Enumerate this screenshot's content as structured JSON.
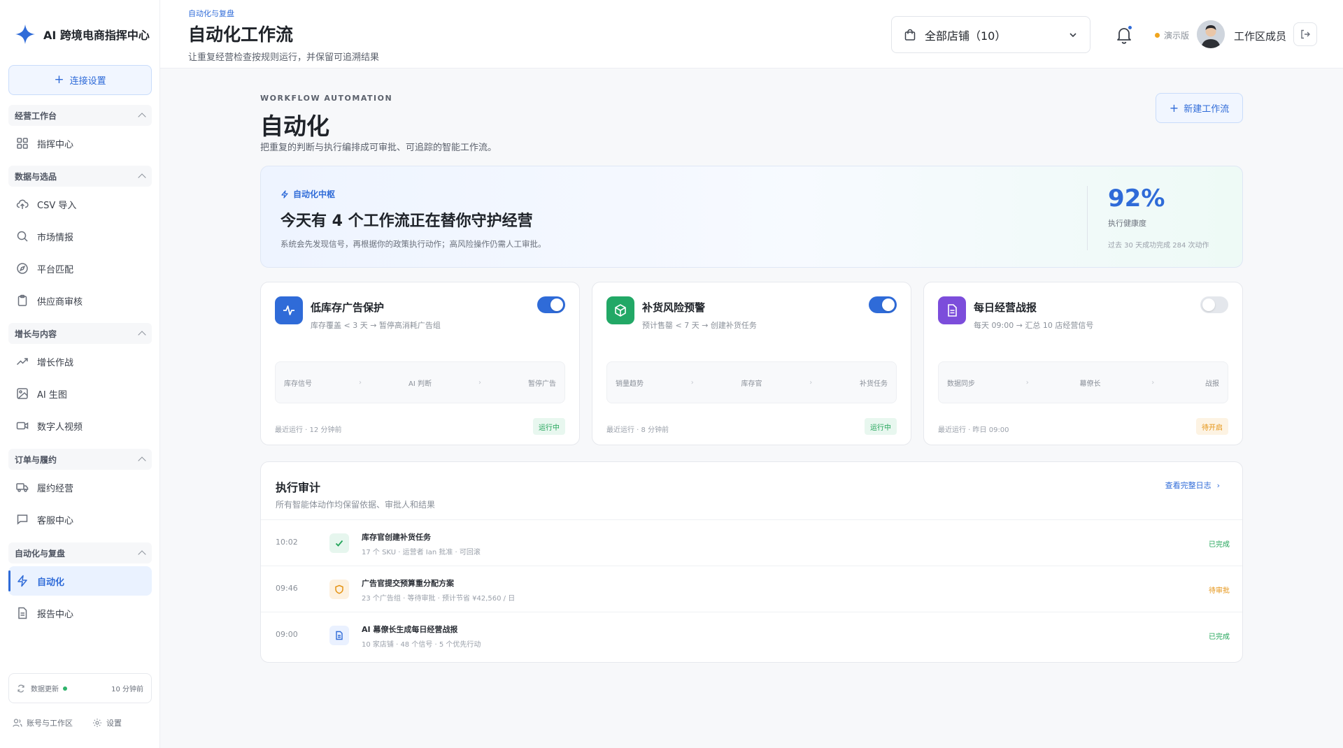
{
  "app": {
    "name": "AI 跨境电商指挥中心"
  },
  "sidebar": {
    "connect_label": "连接设置",
    "groups": [
      {
        "title": "经营工作台",
        "items": [
          {
            "label": "指挥中心",
            "icon": "grid-icon"
          }
        ]
      },
      {
        "title": "数据与选品",
        "items": [
          {
            "label": "CSV 导入",
            "icon": "upload-cloud-icon"
          },
          {
            "label": "市场情报",
            "icon": "search-icon"
          },
          {
            "label": "平台匹配",
            "icon": "compass-icon"
          },
          {
            "label": "供应商审核",
            "icon": "clipboard-icon"
          }
        ]
      },
      {
        "title": "增长与内容",
        "items": [
          {
            "label": "增长作战",
            "icon": "trending-up-icon"
          },
          {
            "label": "AI 生图",
            "icon": "image-icon"
          },
          {
            "label": "数字人视频",
            "icon": "video-icon"
          }
        ]
      },
      {
        "title": "订单与履约",
        "items": [
          {
            "label": "履约经营",
            "icon": "truck-icon"
          },
          {
            "label": "客服中心",
            "icon": "message-icon"
          }
        ]
      },
      {
        "title": "自动化与复盘",
        "items": [
          {
            "label": "自动化",
            "icon": "lightning-icon",
            "active": true
          },
          {
            "label": "报告中心",
            "icon": "document-icon"
          }
        ]
      }
    ],
    "data_update": {
      "label": "数据更新",
      "time": "10 分钟前"
    },
    "bottom": {
      "account": "账号与工作区",
      "settings": "设置"
    }
  },
  "header": {
    "breadcrumb": "自动化与复盘",
    "title": "自动化工作流",
    "subtitle": "让重复经营检查按规则运行，并保留可追溯结果",
    "store_select": "全部店铺（10）",
    "demo_label": "演示版",
    "member": "工作区成员"
  },
  "main": {
    "kicker": "WORKFLOW AUTOMATION",
    "title": "自动化",
    "subtitle": "把重复的判断与执行编排成可审批、可追踪的智能工作流。",
    "new_button": "新建工作流",
    "hero": {
      "tag": "自动化中枢",
      "headline": "今天有 4 个工作流正在替你守护经营",
      "desc": "系统会先发现信号，再根据你的政策执行动作；高风险操作仍需人工审批。",
      "pct": "92%",
      "pct_label": "执行健康度",
      "pct_note": "过去 30 天成功完成 284 次动作"
    },
    "cards": [
      {
        "title": "低库存广告保护",
        "desc": "库存覆盖 < 3 天 → 暂停高消耗广告组",
        "enabled": true,
        "icon": "pulse-icon",
        "color": "#2f6bd8",
        "flow": [
          "库存信号",
          "AI 判断",
          "暂停广告"
        ],
        "last_run": "最近运行 · 12 分钟前",
        "status": "运行中"
      },
      {
        "title": "补货风险预警",
        "desc": "预计售罄 < 7 天 → 创建补货任务",
        "enabled": true,
        "icon": "box-icon",
        "color": "#22a866",
        "flow": [
          "销量趋势",
          "库存官",
          "补货任务"
        ],
        "last_run": "最近运行 · 8 分钟前",
        "status": "运行中"
      },
      {
        "title": "每日经营战报",
        "desc": "每天 09:00 → 汇总 10 店经营信号",
        "enabled": false,
        "icon": "document-icon",
        "color": "#7c4ddb",
        "flow": [
          "数据同步",
          "幕僚长",
          "战报"
        ],
        "last_run": "最近运行 · 昨日 09:00",
        "status": "待开启"
      }
    ],
    "audit": {
      "title": "执行审计",
      "subtitle": "所有智能体动作均保留依据、审批人和结果",
      "link": "查看完整日志",
      "rows": [
        {
          "time": "10:02",
          "icon": "check-icon",
          "name": "库存官创建补货任务",
          "detail": "17 个 SKU · 运营者 Ian 批准 · 可回滚",
          "status": "已完成"
        },
        {
          "time": "09:46",
          "icon": "shield-icon",
          "name": "广告官提交预算重分配方案",
          "detail": "23 个广告组 · 等待审批 · 预计节省 ¥42,560 / 日",
          "status": "待审批"
        },
        {
          "time": "09:00",
          "icon": "document-icon",
          "name": "AI 幕僚长生成每日经营战报",
          "detail": "10 家店铺 · 48 个信号 · 5 个优先行动",
          "status": "已完成"
        }
      ]
    }
  }
}
